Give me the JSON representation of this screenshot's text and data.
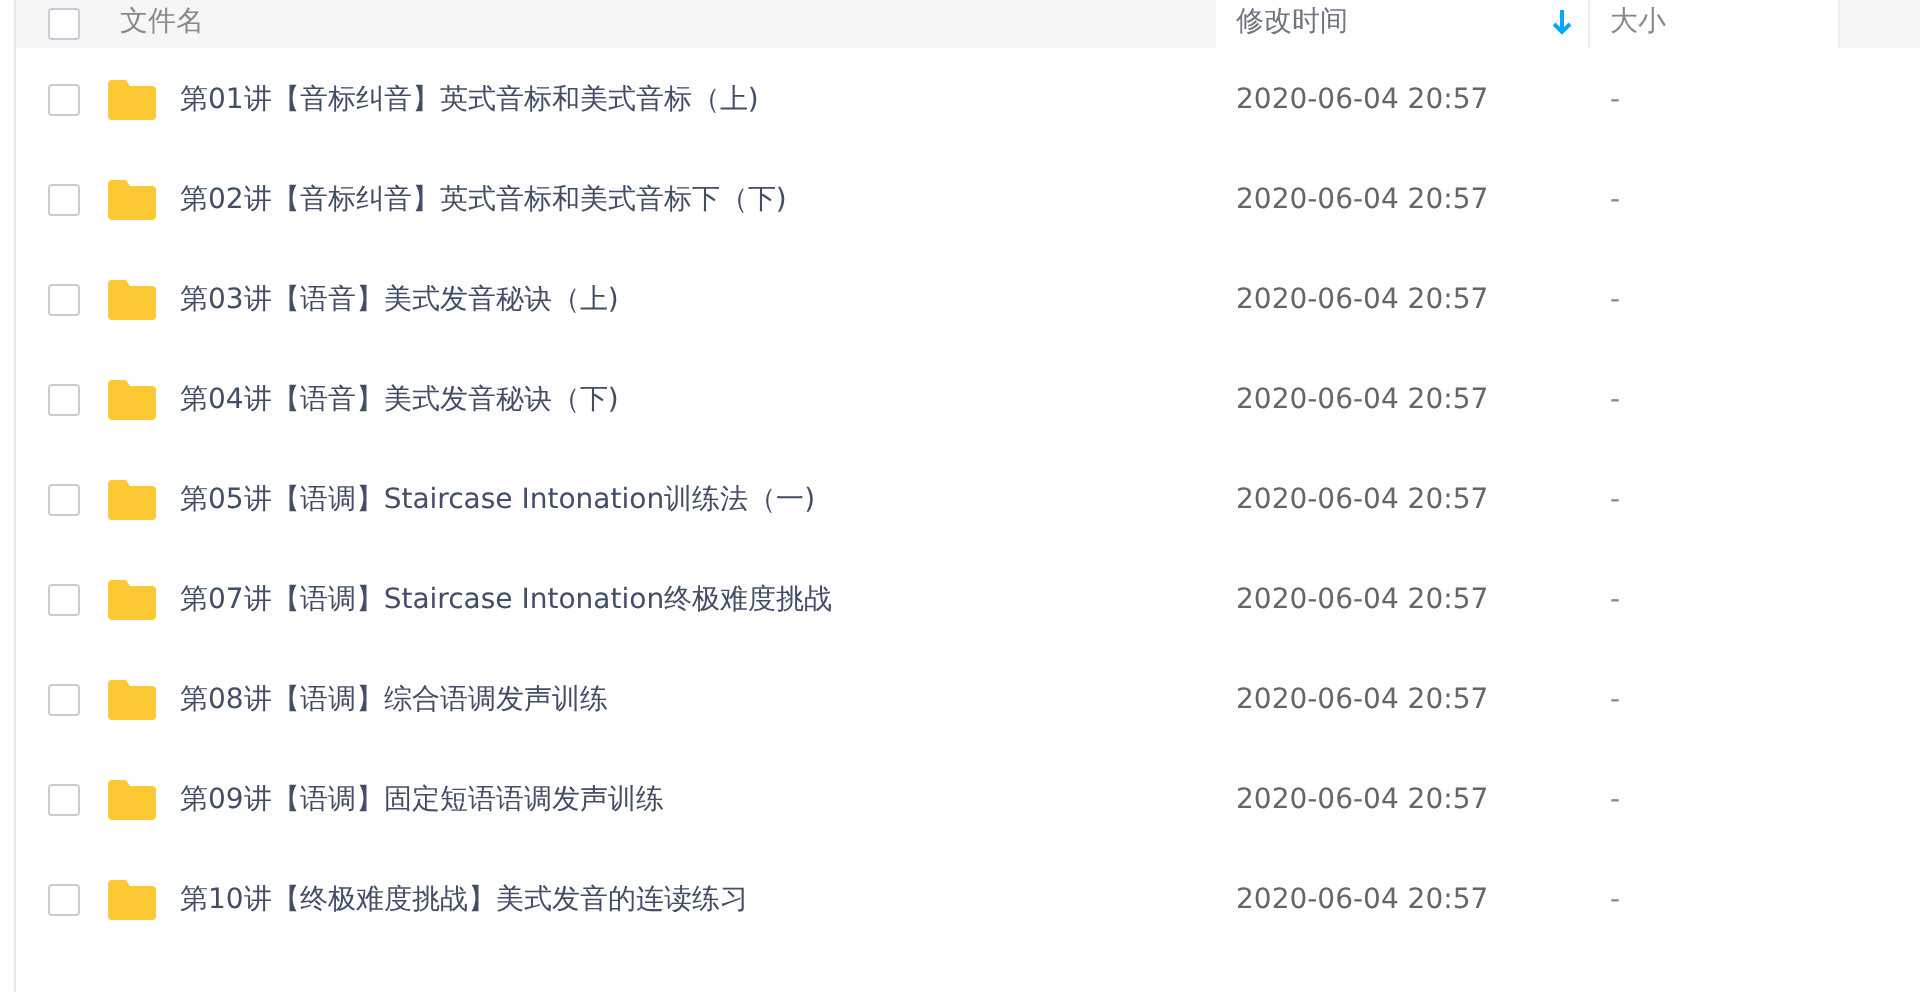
{
  "header": {
    "columns": [
      {
        "label": "文件名",
        "sorted": false
      },
      {
        "label": "修改时间",
        "sorted": true
      },
      {
        "label": "大小",
        "sorted": false
      }
    ],
    "select_all": false
  },
  "rows": [
    {
      "name": "第01讲【音标纠音】英式音标和美式音标（上)",
      "modified": "2020-06-04 20:57",
      "size": "-",
      "selected": false
    },
    {
      "name": "第02讲【音标纠音】英式音标和美式音标下（下)",
      "modified": "2020-06-04 20:57",
      "size": "-",
      "selected": false
    },
    {
      "name": "第03讲【语音】美式发音秘诀（上)",
      "modified": "2020-06-04 20:57",
      "size": "-",
      "selected": false
    },
    {
      "name": "第04讲【语音】美式发音秘诀（下)",
      "modified": "2020-06-04 20:57",
      "size": "-",
      "selected": false
    },
    {
      "name": "第05讲【语调】Staircase Intonation训练法（一)",
      "modified": "2020-06-04 20:57",
      "size": "-",
      "selected": false
    },
    {
      "name": "第07讲【语调】Staircase Intonation终极难度挑战",
      "modified": "2020-06-04 20:57",
      "size": "-",
      "selected": false
    },
    {
      "name": "第08讲【语调】综合语调发声训练",
      "modified": "2020-06-04 20:57",
      "size": "-",
      "selected": false
    },
    {
      "name": "第09讲【语调】固定短语语调发声训练",
      "modified": "2020-06-04 20:57",
      "size": "-",
      "selected": false
    },
    {
      "name": "第10讲【终极难度挑战】美式发音的连读练习",
      "modified": "2020-06-04 20:57",
      "size": "-",
      "selected": false
    }
  ]
}
